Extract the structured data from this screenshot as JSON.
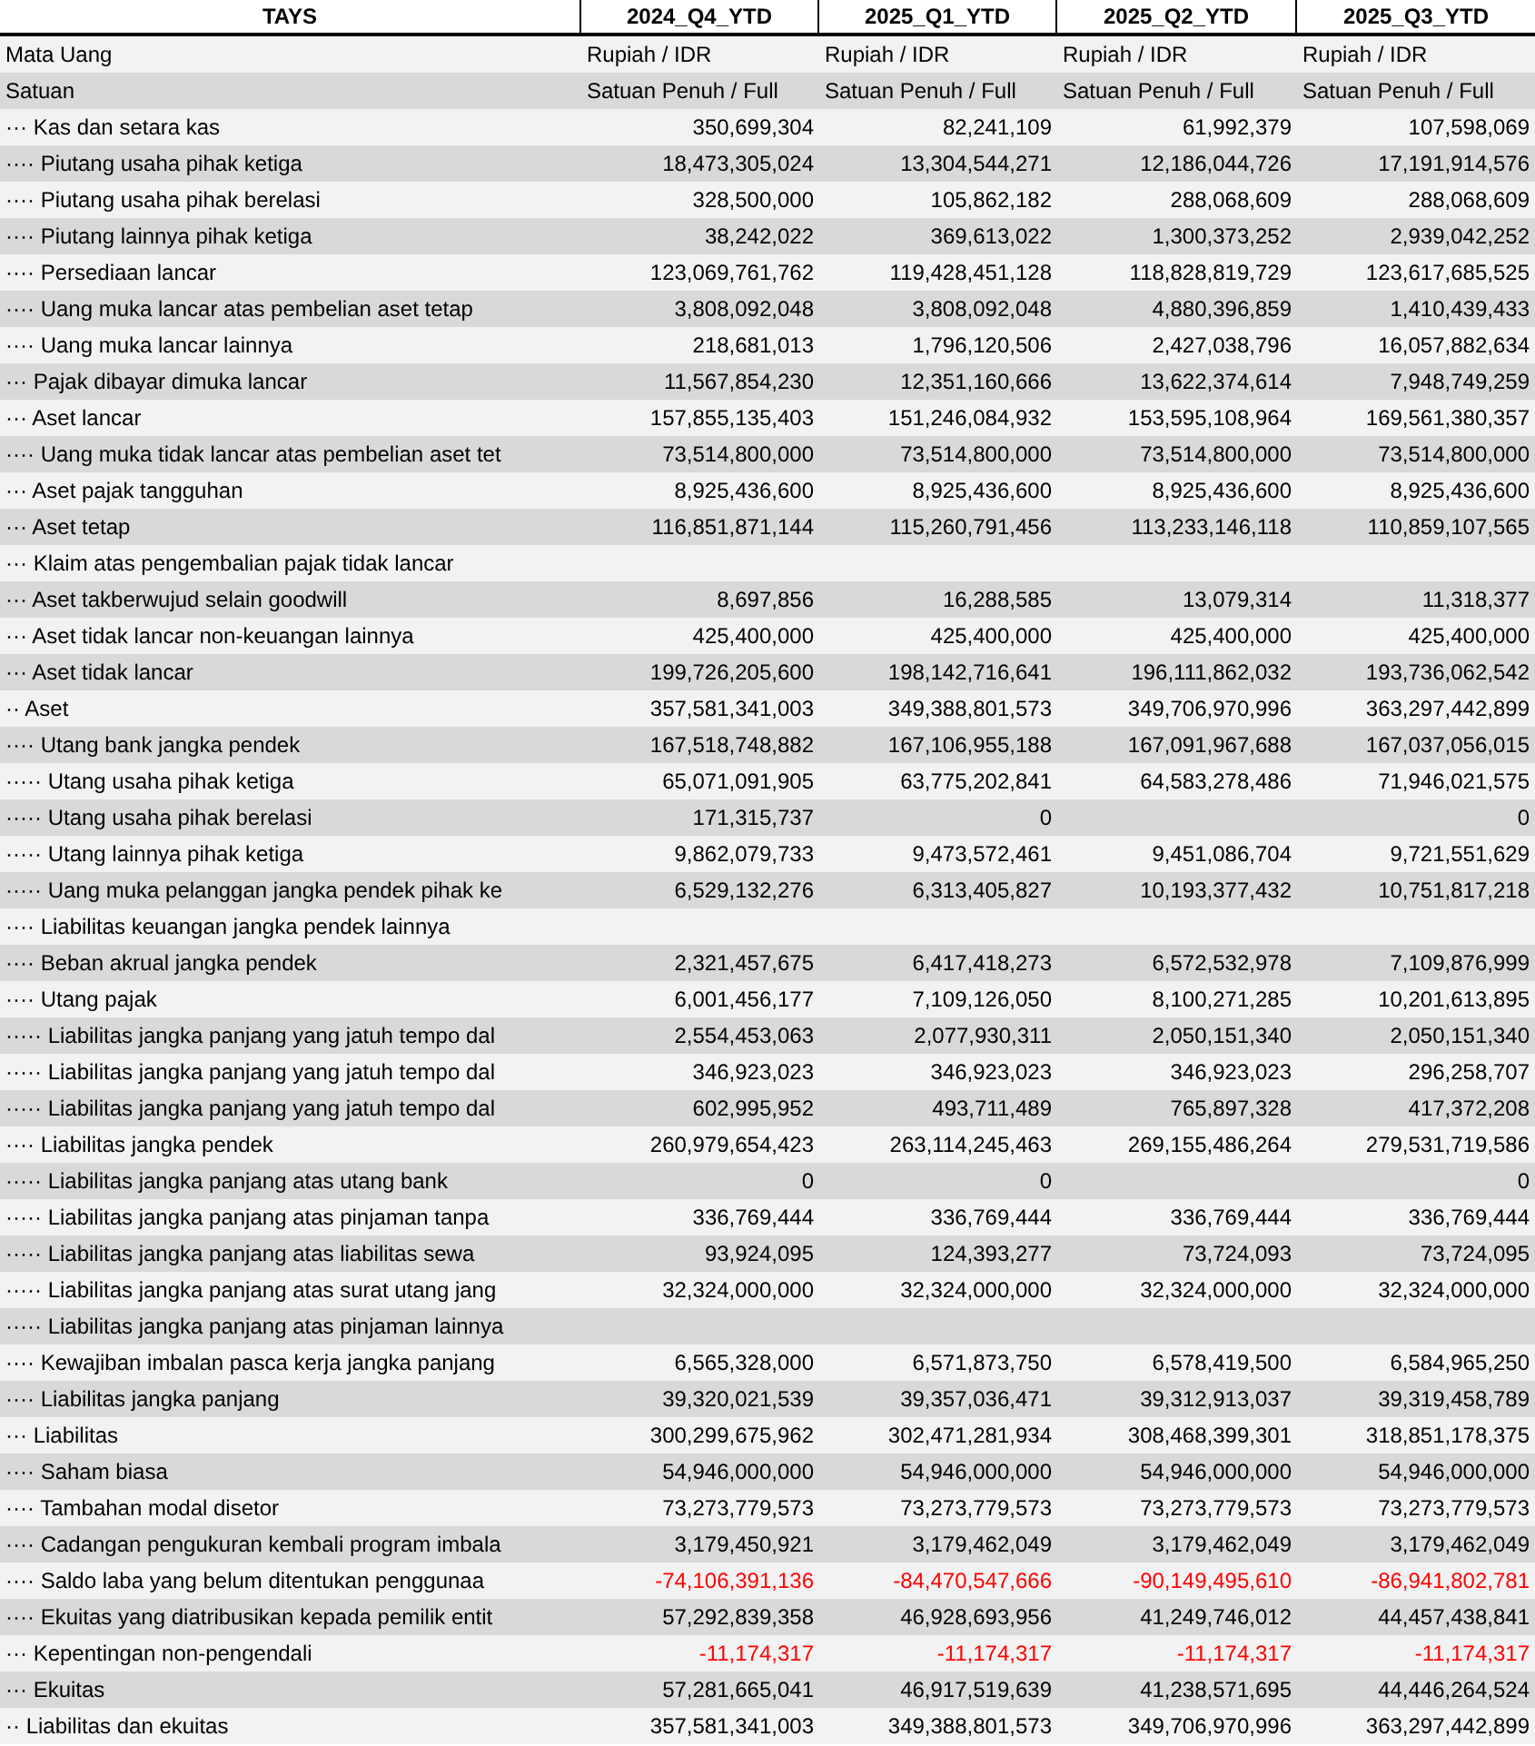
{
  "table": {
    "columns": [
      "TAYS",
      "2024_Q4_YTD",
      "2025_Q1_YTD",
      "2025_Q2_YTD",
      "2025_Q3_YTD"
    ],
    "rows": [
      {
        "kind": "text",
        "label": "Mata Uang",
        "values": {
          "col_1": "Rupiah / IDR",
          "col_2": "Rupiah / IDR",
          "col_3": "Rupiah / IDR",
          "col_4": "Rupiah / IDR"
        }
      },
      {
        "kind": "text",
        "label": "Satuan",
        "values": {
          "col_1": "Satuan Penuh / Full",
          "col_2": "Satuan Penuh / Full",
          "col_3": "Satuan Penuh / Full",
          "col_4": "Satuan Penuh / Full"
        }
      },
      {
        "kind": "number",
        "label": "··· Kas dan setara kas",
        "values": {
          "col_1": "350,699,304",
          "col_2": "82,241,109",
          "col_3": "61,992,379",
          "col_4": "107,598,069"
        }
      },
      {
        "kind": "number",
        "label": "···· Piutang usaha pihak ketiga",
        "values": {
          "col_1": "18,473,305,024",
          "col_2": "13,304,544,271",
          "col_3": "12,186,044,726",
          "col_4": "17,191,914,576"
        }
      },
      {
        "kind": "number",
        "label": "···· Piutang usaha pihak berelasi",
        "values": {
          "col_1": "328,500,000",
          "col_2": "105,862,182",
          "col_3": "288,068,609",
          "col_4": "288,068,609"
        }
      },
      {
        "kind": "number",
        "label": "···· Piutang lainnya pihak ketiga",
        "values": {
          "col_1": "38,242,022",
          "col_2": "369,613,022",
          "col_3": "1,300,373,252",
          "col_4": "2,939,042,252"
        }
      },
      {
        "kind": "number",
        "label": "···· Persediaan lancar",
        "values": {
          "col_1": "123,069,761,762",
          "col_2": "119,428,451,128",
          "col_3": "118,828,819,729",
          "col_4": "123,617,685,525"
        }
      },
      {
        "kind": "number",
        "label": "···· Uang muka lancar atas pembelian aset tetap",
        "values": {
          "col_1": "3,808,092,048",
          "col_2": "3,808,092,048",
          "col_3": "4,880,396,859",
          "col_4": "1,410,439,433"
        }
      },
      {
        "kind": "number",
        "label": "···· Uang muka lancar lainnya",
        "values": {
          "col_1": "218,681,013",
          "col_2": "1,796,120,506",
          "col_3": "2,427,038,796",
          "col_4": "16,057,882,634"
        }
      },
      {
        "kind": "number",
        "label": "··· Pajak dibayar dimuka lancar",
        "values": {
          "col_1": "11,567,854,230",
          "col_2": "12,351,160,666",
          "col_3": "13,622,374,614",
          "col_4": "7,948,749,259"
        }
      },
      {
        "kind": "number",
        "label": "··· Aset lancar",
        "values": {
          "col_1": "157,855,135,403",
          "col_2": "151,246,084,932",
          "col_3": "153,595,108,964",
          "col_4": "169,561,380,357"
        }
      },
      {
        "kind": "number",
        "label": "···· Uang muka tidak lancar atas pembelian aset tet",
        "values": {
          "col_1": "73,514,800,000",
          "col_2": "73,514,800,000",
          "col_3": "73,514,800,000",
          "col_4": "73,514,800,000"
        }
      },
      {
        "kind": "number",
        "label": "··· Aset pajak tangguhan",
        "values": {
          "col_1": "8,925,436,600",
          "col_2": "8,925,436,600",
          "col_3": "8,925,436,600",
          "col_4": "8,925,436,600"
        }
      },
      {
        "kind": "number",
        "label": "··· Aset tetap",
        "values": {
          "col_1": "116,851,871,144",
          "col_2": "115,260,791,456",
          "col_3": "113,233,146,118",
          "col_4": "110,859,107,565"
        }
      },
      {
        "label": "··· Klaim atas pengembalian pajak tidak lancar"
      },
      {
        "kind": "number",
        "label": "··· Aset takberwujud selain goodwill",
        "values": {
          "col_1": "8,697,856",
          "col_2": "16,288,585",
          "col_3": "13,079,314",
          "col_4": "11,318,377"
        }
      },
      {
        "kind": "number",
        "label": "··· Aset tidak lancar non-keuangan lainnya",
        "values": {
          "col_1": "425,400,000",
          "col_2": "425,400,000",
          "col_3": "425,400,000",
          "col_4": "425,400,000"
        }
      },
      {
        "kind": "number",
        "label": "··· Aset tidak lancar",
        "values": {
          "col_1": "199,726,205,600",
          "col_2": "198,142,716,641",
          "col_3": "196,111,862,032",
          "col_4": "193,736,062,542"
        }
      },
      {
        "kind": "number",
        "label": "·· Aset",
        "values": {
          "col_1": "357,581,341,003",
          "col_2": "349,388,801,573",
          "col_3": "349,706,970,996",
          "col_4": "363,297,442,899"
        }
      },
      {
        "kind": "number",
        "label": "···· Utang bank jangka pendek",
        "values": {
          "col_1": "167,518,748,882",
          "col_2": "167,106,955,188",
          "col_3": "167,091,967,688",
          "col_4": "167,037,056,015"
        }
      },
      {
        "kind": "number",
        "label": "····· Utang usaha pihak ketiga",
        "values": {
          "col_1": "65,071,091,905",
          "col_2": "63,775,202,841",
          "col_3": "64,583,278,486",
          "col_4": "71,946,021,575"
        }
      },
      {
        "kind": "number",
        "label": "····· Utang usaha pihak berelasi",
        "values": {
          "col_1": "171,315,737",
          "col_2": "0",
          "col_4": "0"
        }
      },
      {
        "kind": "number",
        "label": "····· Utang lainnya pihak ketiga",
        "values": {
          "col_1": "9,862,079,733",
          "col_2": "9,473,572,461",
          "col_3": "9,451,086,704",
          "col_4": "9,721,551,629"
        }
      },
      {
        "kind": "number",
        "label": "····· Uang muka pelanggan jangka pendek pihak ke",
        "values": {
          "col_1": "6,529,132,276",
          "col_2": "6,313,405,827",
          "col_3": "10,193,377,432",
          "col_4": "10,751,817,218"
        }
      },
      {
        "label": "···· Liabilitas keuangan jangka pendek lainnya"
      },
      {
        "kind": "number",
        "label": "···· Beban akrual jangka pendek",
        "values": {
          "col_1": "2,321,457,675",
          "col_2": "6,417,418,273",
          "col_3": "6,572,532,978",
          "col_4": "7,109,876,999"
        }
      },
      {
        "kind": "number",
        "label": "···· Utang pajak",
        "values": {
          "col_1": "6,001,456,177",
          "col_2": "7,109,126,050",
          "col_3": "8,100,271,285",
          "col_4": "10,201,613,895"
        }
      },
      {
        "kind": "number",
        "label": "····· Liabilitas jangka panjang yang jatuh tempo dal",
        "values": {
          "col_1": "2,554,453,063",
          "col_2": "2,077,930,311",
          "col_3": "2,050,151,340",
          "col_4": "2,050,151,340"
        }
      },
      {
        "kind": "number",
        "label": "····· Liabilitas jangka panjang yang jatuh tempo dal",
        "values": {
          "col_1": "346,923,023",
          "col_2": "346,923,023",
          "col_3": "346,923,023",
          "col_4": "296,258,707"
        }
      },
      {
        "kind": "number",
        "label": "····· Liabilitas jangka panjang yang jatuh tempo dal",
        "values": {
          "col_1": "602,995,952",
          "col_2": "493,711,489",
          "col_3": "765,897,328",
          "col_4": "417,372,208"
        }
      },
      {
        "kind": "number",
        "label": "···· Liabilitas jangka pendek",
        "values": {
          "col_1": "260,979,654,423",
          "col_2": "263,114,245,463",
          "col_3": "269,155,486,264",
          "col_4": "279,531,719,586"
        }
      },
      {
        "kind": "number",
        "label": "····· Liabilitas jangka panjang atas utang bank",
        "values": {
          "col_1": "0",
          "col_2": "0",
          "col_4": "0"
        }
      },
      {
        "kind": "number",
        "label": "····· Liabilitas jangka panjang atas pinjaman tanpa",
        "values": {
          "col_1": "336,769,444",
          "col_2": "336,769,444",
          "col_3": "336,769,444",
          "col_4": "336,769,444"
        }
      },
      {
        "kind": "number",
        "label": "····· Liabilitas jangka panjang atas liabilitas sewa",
        "values": {
          "col_1": "93,924,095",
          "col_2": "124,393,277",
          "col_3": "73,724,093",
          "col_4": "73,724,095"
        }
      },
      {
        "kind": "number",
        "label": "····· Liabilitas jangka panjang atas surat utang jang",
        "values": {
          "col_1": "32,324,000,000",
          "col_2": "32,324,000,000",
          "col_3": "32,324,000,000",
          "col_4": "32,324,000,000"
        }
      },
      {
        "label": "····· Liabilitas jangka panjang atas pinjaman lainnya"
      },
      {
        "kind": "number",
        "label": "···· Kewajiban imbalan pasca kerja jangka panjang",
        "values": {
          "col_1": "6,565,328,000",
          "col_2": "6,571,873,750",
          "col_3": "6,578,419,500",
          "col_4": "6,584,965,250"
        }
      },
      {
        "kind": "number",
        "label": "···· Liabilitas jangka panjang",
        "values": {
          "col_1": "39,320,021,539",
          "col_2": "39,357,036,471",
          "col_3": "39,312,913,037",
          "col_4": "39,319,458,789"
        }
      },
      {
        "kind": "number",
        "label": "··· Liabilitas",
        "values": {
          "col_1": "300,299,675,962",
          "col_2": "302,471,281,934",
          "col_3": "308,468,399,301",
          "col_4": "318,851,178,375"
        }
      },
      {
        "kind": "number",
        "label": "···· Saham biasa",
        "values": {
          "col_1": "54,946,000,000",
          "col_2": "54,946,000,000",
          "col_3": "54,946,000,000",
          "col_4": "54,946,000,000"
        }
      },
      {
        "kind": "number",
        "label": "···· Tambahan modal disetor",
        "values": {
          "col_1": "73,273,779,573",
          "col_2": "73,273,779,573",
          "col_3": "73,273,779,573",
          "col_4": "73,273,779,573"
        }
      },
      {
        "kind": "number",
        "label": "···· Cadangan pengukuran kembali program imbala",
        "values": {
          "col_1": "3,179,450,921",
          "col_2": "3,179,462,049",
          "col_3": "3,179,462,049",
          "col_4": "3,179,462,049"
        }
      },
      {
        "kind": "number",
        "negative": true,
        "label": "···· Saldo laba yang belum ditentukan penggunaa",
        "values": {
          "col_1": "-74,106,391,136",
          "col_2": "-84,470,547,666",
          "col_3": "-90,149,495,610",
          "col_4": "-86,941,802,781"
        }
      },
      {
        "kind": "number",
        "label": "···· Ekuitas yang diatribusikan kepada pemilik entit",
        "values": {
          "col_1": "57,292,839,358",
          "col_2": "46,928,693,956",
          "col_3": "41,249,746,012",
          "col_4": "44,457,438,841"
        }
      },
      {
        "kind": "number",
        "negative": true,
        "label": "··· Kepentingan non-pengendali",
        "values": {
          "col_1": "-11,174,317",
          "col_2": "-11,174,317",
          "col_3": "-11,174,317",
          "col_4": "-11,174,317"
        }
      },
      {
        "kind": "number",
        "label": "··· Ekuitas",
        "values": {
          "col_1": "57,281,665,041",
          "col_2": "46,917,519,639",
          "col_3": "41,238,571,695",
          "col_4": "44,446,264,524"
        }
      },
      {
        "kind": "number",
        "label": "·· Liabilitas dan ekuitas",
        "values": {
          "col_1": "357,581,341,003",
          "col_2": "349,388,801,573",
          "col_3": "349,706,970,996",
          "col_4": "363,297,442,899"
        }
      }
    ]
  }
}
